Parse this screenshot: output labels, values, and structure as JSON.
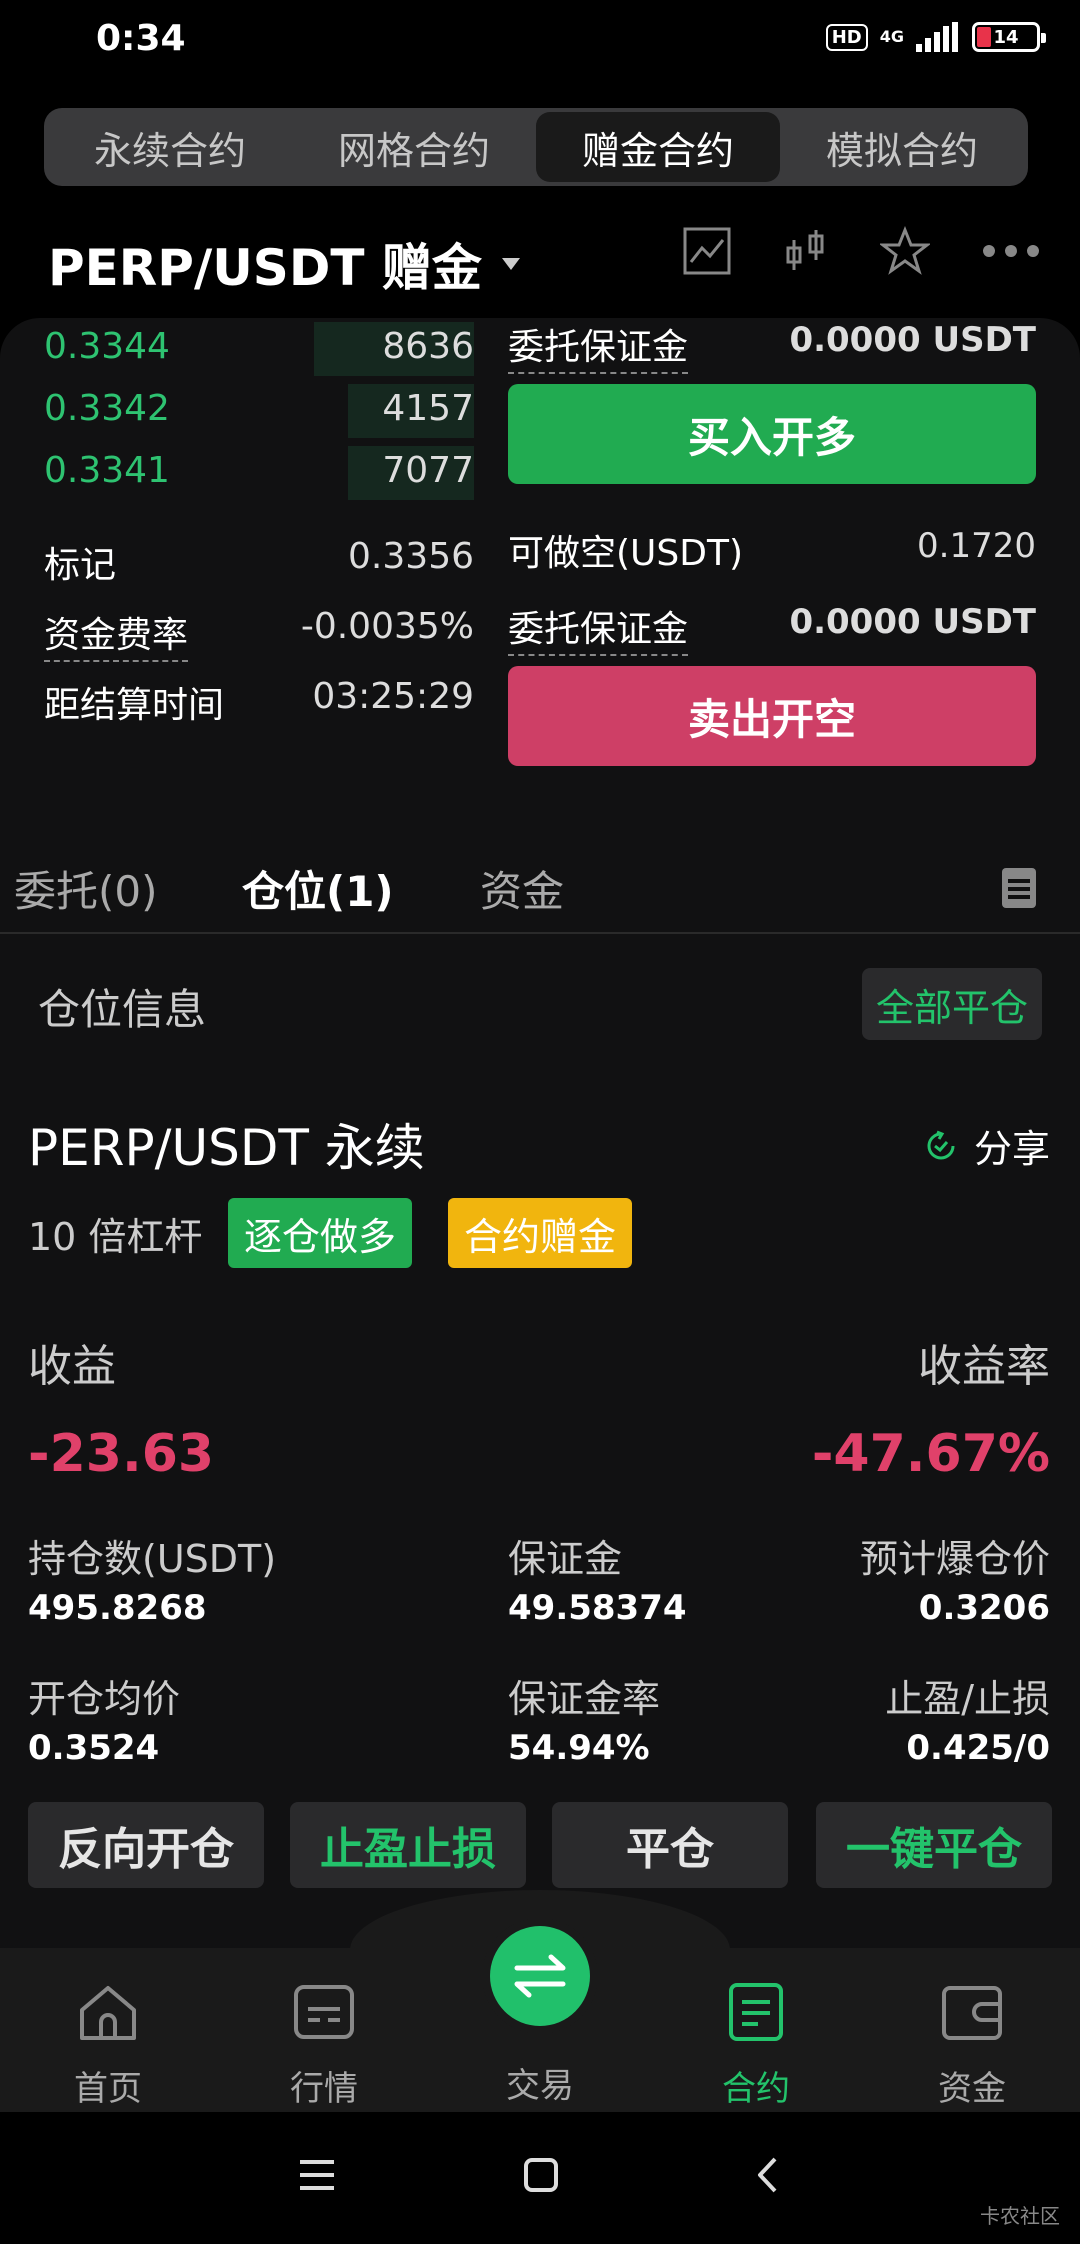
{
  "status": {
    "time": "0:34",
    "hd": "HD",
    "network": "4G",
    "battery": "14"
  },
  "segments": [
    "永续合约",
    "网格合约",
    "赠金合约",
    "模拟合约"
  ],
  "pair": {
    "name": "PERP/USDT 赠金"
  },
  "orderbook": [
    {
      "price": "0.3344",
      "qty": "8636",
      "depth": 0.52
    },
    {
      "price": "0.3342",
      "qty": "4157",
      "depth": 0.4
    },
    {
      "price": "0.3341",
      "qty": "7077",
      "depth": 0.4
    }
  ],
  "left_info": {
    "mark_label": "标记",
    "mark_value": "0.3356",
    "funding_label": "资金费率",
    "funding_value": "-0.0035%",
    "settle_label": "距结算时间",
    "settle_value": "03:25:29"
  },
  "right_panel": {
    "margin_label_1": "委托保证金",
    "margin_value_1": "0.0000 USDT",
    "buy_label": "买入开多",
    "short_label": "可做空(USDT)",
    "short_value": "0.1720",
    "margin_label_2": "委托保证金",
    "margin_value_2": "0.0000 USDT",
    "sell_label": "卖出开空"
  },
  "order_tabs": {
    "orders": "委托(0)",
    "positions": "仓位(1)",
    "funds": "资金"
  },
  "position_section": {
    "title": "仓位信息",
    "close_all": "全部平仓"
  },
  "position": {
    "title": "PERP/USDT 永续",
    "share": "分享",
    "leverage": "10 倍杠杆",
    "tag_mode": "逐仓做多",
    "tag_bonus": "合约赠金",
    "pnl_label": "收益",
    "pnl_value": "-23.63",
    "roe_label": "收益率",
    "roe_value": "-47.67%",
    "size_label": "持仓数(USDT)",
    "size_value": "495.8268",
    "margin_label": "保证金",
    "margin_value": "49.58374",
    "liq_label": "预计爆仓价",
    "liq_value": "0.3206",
    "entry_label": "开仓均价",
    "entry_value": "0.3524",
    "margin_rate_label": "保证金率",
    "margin_rate_value": "54.94%",
    "tpsl_label": "止盈/止损",
    "tpsl_value": "0.425/0"
  },
  "actions": [
    "反向开仓",
    "止盈止损",
    "平仓",
    "一键平仓"
  ],
  "bottom_nav": [
    "首页",
    "行情",
    "交易",
    "合约",
    "资金"
  ],
  "watermark": "卡农社区",
  "colors": {
    "green": "#21ab51",
    "red": "#ce3f66",
    "accent": "#23c36b",
    "loss": "#e0416a"
  }
}
